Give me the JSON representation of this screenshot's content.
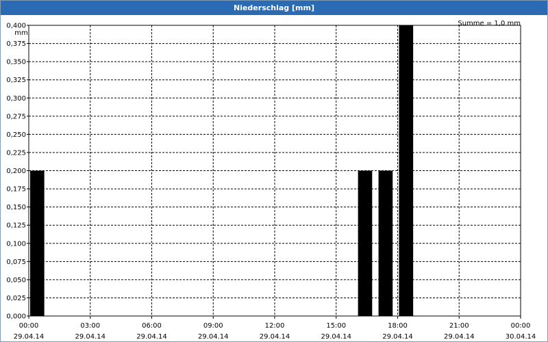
{
  "window": {
    "title": "Niederschlag [mm]"
  },
  "chart_data": {
    "type": "bar",
    "title": "Niederschlag [mm]",
    "ylabel": "mm",
    "sum_label": "Summe = 1,0 mm",
    "ylim": [
      0,
      0.4
    ],
    "y_ticks": [
      "0,000",
      "0,025",
      "0,050",
      "0,075",
      "0,100",
      "0,125",
      "0,150",
      "0,175",
      "0,200",
      "0,225",
      "0,250",
      "0,275",
      "0,300",
      "0,325",
      "0,350",
      "0,375",
      "0,400"
    ],
    "x_ticks": [
      {
        "time": "00:00",
        "date": "29.04.14"
      },
      {
        "time": "03:00",
        "date": "29.04.14"
      },
      {
        "time": "06:00",
        "date": "29.04.14"
      },
      {
        "time": "09:00",
        "date": "29.04.14"
      },
      {
        "time": "12:00",
        "date": "29.04.14"
      },
      {
        "time": "15:00",
        "date": "29.04.14"
      },
      {
        "time": "18:00",
        "date": "29.04.14"
      },
      {
        "time": "21:00",
        "date": "29.04.14"
      },
      {
        "time": "00:00",
        "date": "30.04.14"
      }
    ],
    "x_range": [
      "29.04.14 00:00",
      "30.04.14 00:00"
    ],
    "bars": [
      {
        "time": "29.04.14 00:00",
        "value": 0.2
      },
      {
        "time": "29.04.14 16:00",
        "value": 0.2
      },
      {
        "time": "29.04.14 17:00",
        "value": 0.2
      },
      {
        "time": "29.04.14 18:00",
        "value": 0.4
      }
    ],
    "bar_color": "#000000",
    "grid": true
  }
}
